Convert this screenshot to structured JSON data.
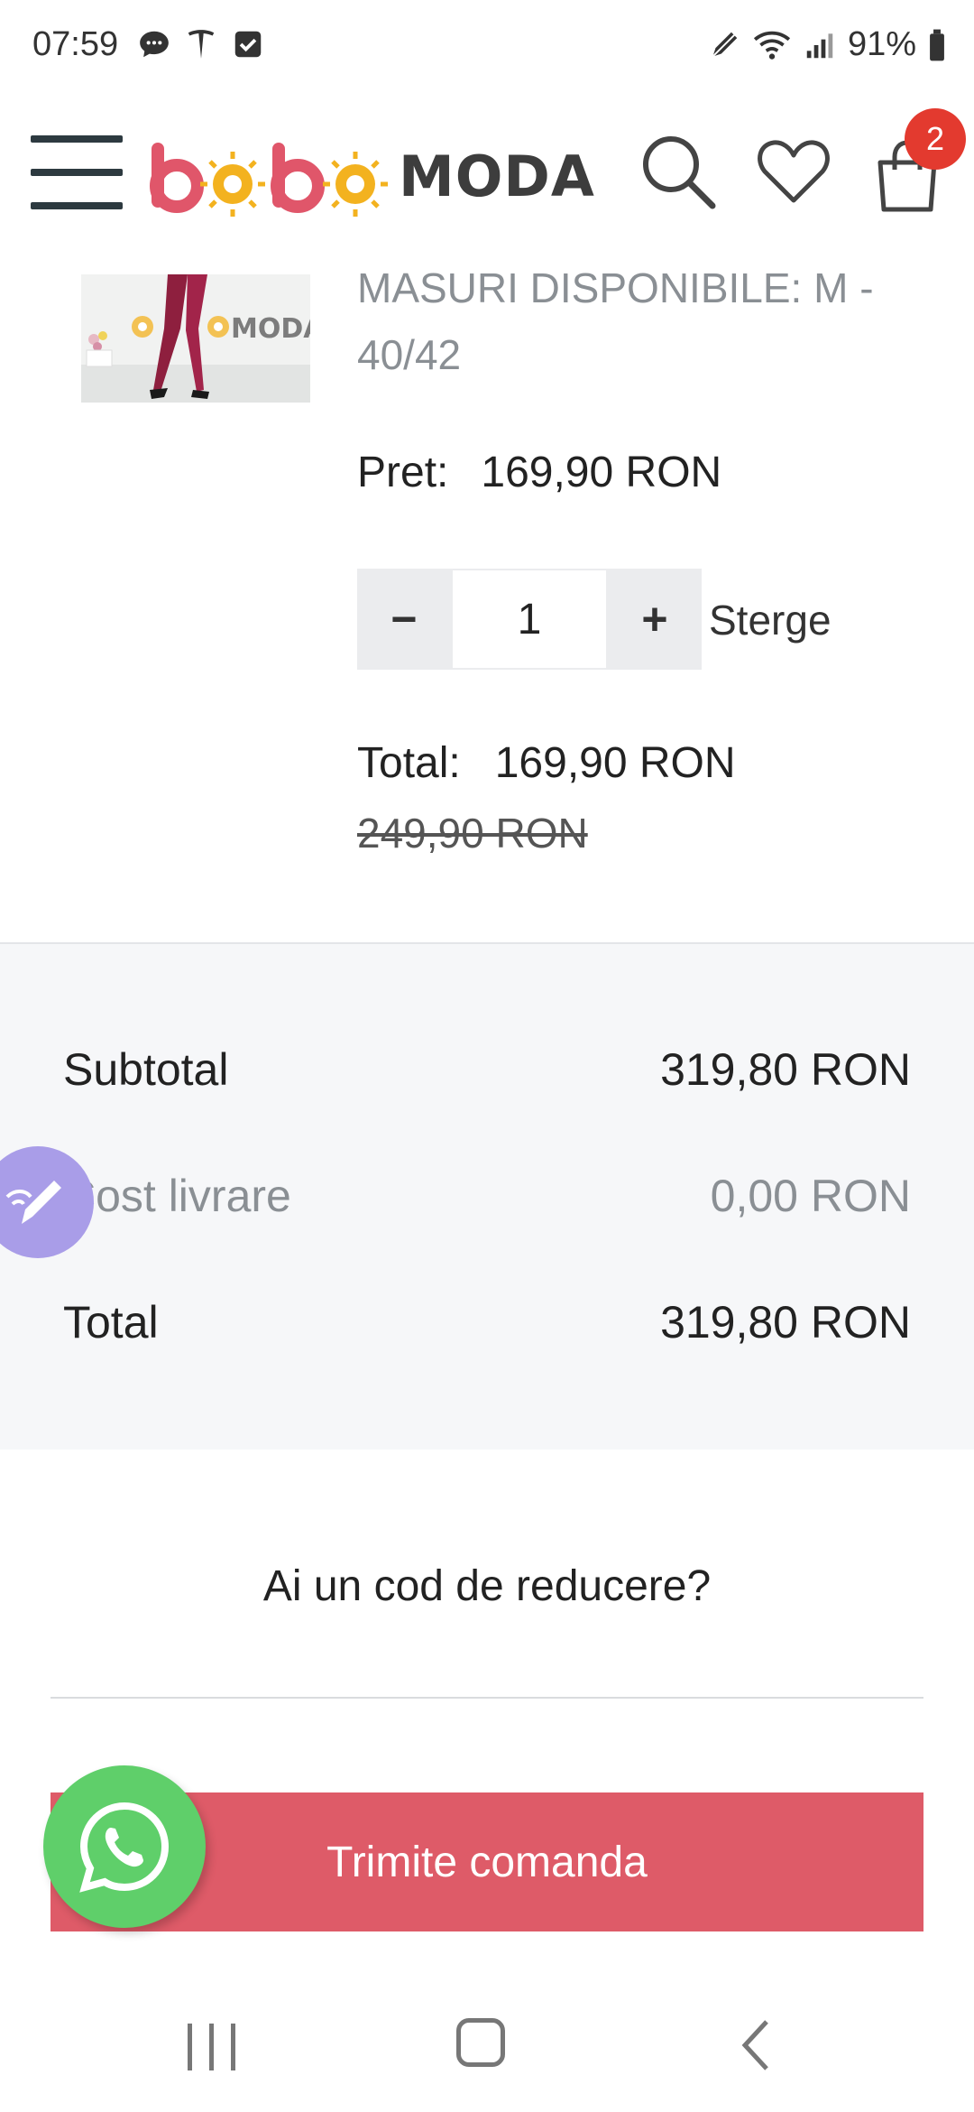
{
  "status_bar": {
    "time": "07:59",
    "battery": "91%",
    "left_icons": [
      "chat-bubble-icon",
      "tesla-icon",
      "checkbox-icon"
    ],
    "right_icons": [
      "pen-icon",
      "wifi-icon",
      "signal-icon",
      "battery-icon"
    ]
  },
  "header": {
    "logo_text": "MODA",
    "logo_colors": {
      "letters": "#e0566a",
      "suns": "#f3b21f",
      "text": "#3d3d3d"
    },
    "cart_count": "2",
    "icons": [
      "menu-icon",
      "search-icon",
      "heart-icon",
      "shopping-bag-icon"
    ]
  },
  "product": {
    "size_text": "MASURI DISPONIBILE: M - 40/42",
    "price_label": "Pret:",
    "price_value": "169,90 RON",
    "quantity": "1",
    "minus_label": "−",
    "plus_label": "+",
    "remove_label": "Sterge",
    "total_label": "Total:",
    "total_value": "169,90 RON",
    "old_price": "249,90 RON",
    "thumb_logo_text": "MODA"
  },
  "summary": {
    "subtotal_label": "Subtotal",
    "subtotal_value": "319,80 RON",
    "shipping_label": "Cost livrare",
    "shipping_value": "0,00 RON",
    "total_label": "Total",
    "total_value": "319,80 RON"
  },
  "discount": {
    "label": "Ai un cod de reducere?"
  },
  "submit": {
    "label": "Trimite comanda",
    "color": "#de5b68"
  },
  "colors": {
    "whatsapp": "#5fcf6a",
    "edit_fab": "#a99de8",
    "badge": "#e33a2f"
  }
}
